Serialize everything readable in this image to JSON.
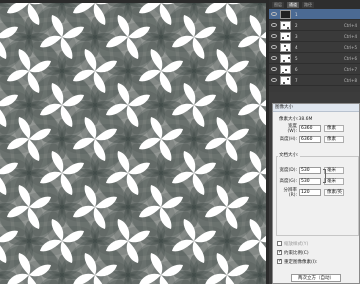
{
  "layers_panel": {
    "tabs": [
      "图层",
      "通道",
      "路径"
    ],
    "layers": [
      {
        "name": "1",
        "shortcut": "",
        "selected": true
      },
      {
        "name": "2",
        "shortcut": "Ctrl+4"
      },
      {
        "name": "3",
        "shortcut": "Ctrl+4"
      },
      {
        "name": "4",
        "shortcut": "Ctrl+5"
      },
      {
        "name": "5",
        "shortcut": "Ctrl+6"
      },
      {
        "name": "6",
        "shortcut": "Ctrl+7"
      },
      {
        "name": "7",
        "shortcut": "Ctrl+8"
      }
    ]
  },
  "image_size_dialog": {
    "title": "图像大小",
    "pixel_size": "像素大小:38.6M",
    "pixel_dims": {
      "width_label": "宽度(W):",
      "width_value": "6360",
      "width_unit": "像素",
      "height_label": "高度(H):",
      "height_value": "6360",
      "height_unit": "像素"
    },
    "doc_size": {
      "title": "文档大小:",
      "width_label": "宽度(D):",
      "width_value": "530",
      "width_unit": "毫米",
      "height_label": "高度(G):",
      "height_value": "530",
      "height_unit": "毫米",
      "res_label": "分辨率(R):",
      "res_value": "120",
      "res_unit": "像素/英"
    },
    "checkboxes": {
      "scale_styles": "缩放样式(Y)",
      "constrain": "约束比例(C)",
      "resample": "重定图像像素(I):"
    },
    "resample_method": "两次立方（自动）"
  },
  "colors": {
    "pattern_bg": "#a8aaa6",
    "petal_dark": "#4a5450",
    "petal_white": "#ffffff",
    "selection": "#4b6a93"
  }
}
